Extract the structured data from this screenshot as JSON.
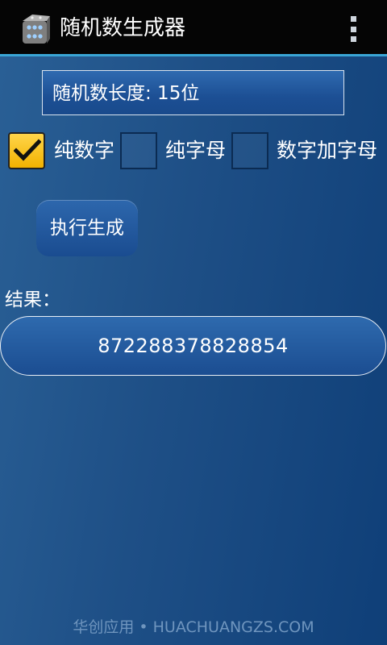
{
  "app": {
    "title": "随机数生成器"
  },
  "length_field": {
    "text": "随机数长度:  15位"
  },
  "options": {
    "digits_only": {
      "label": "纯数字",
      "checked": true
    },
    "letters_only": {
      "label": "纯字母",
      "checked": false
    },
    "mixed": {
      "label": "数字加字母",
      "checked": false
    }
  },
  "generate_button": {
    "label": "执行生成"
  },
  "result": {
    "label": "结果：",
    "value": "872288378828854"
  },
  "footer": {
    "watermark": "华创应用 • HUACHUANGZS.COM"
  },
  "icons": {
    "app": "dice-icon",
    "menu": "overflow-menu-icon",
    "check": "checkmark-icon"
  },
  "colors": {
    "accent": "#3aa6d6",
    "checkbox": "#f2b200",
    "background": "#1e4f86"
  }
}
